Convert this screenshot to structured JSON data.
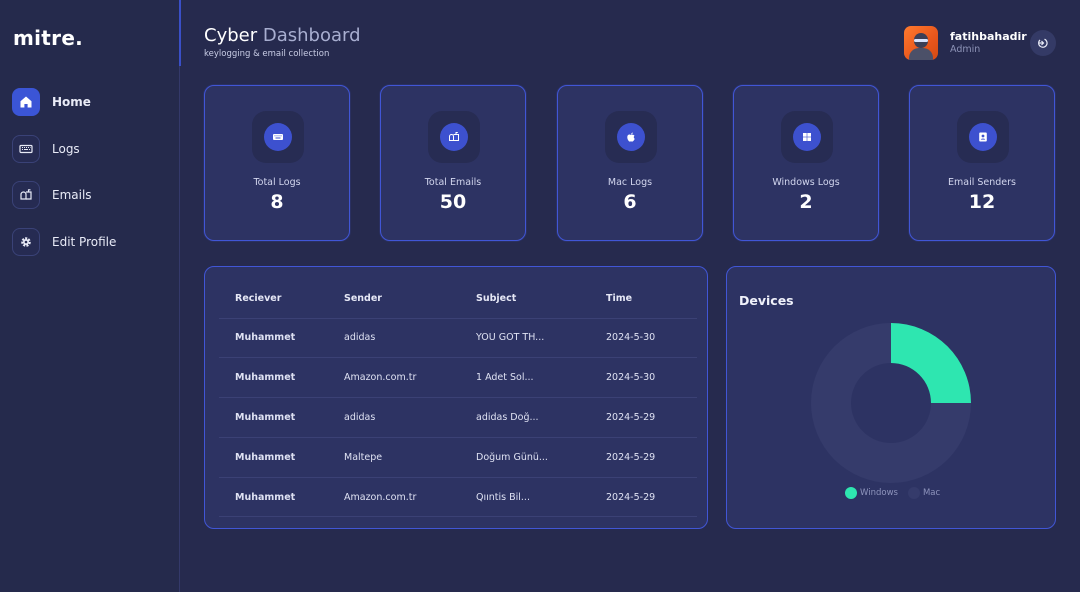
{
  "app": {
    "logo": "mitre."
  },
  "sidebar": {
    "items": [
      {
        "label": "Home",
        "icon": "home-icon",
        "active": true
      },
      {
        "label": "Logs",
        "icon": "keyboard-icon",
        "active": false
      },
      {
        "label": "Emails",
        "icon": "mailbox-icon",
        "active": false
      },
      {
        "label": "Edit Profile",
        "icon": "gear-icon",
        "active": false
      }
    ]
  },
  "header": {
    "title_main": "Cyber",
    "title_accent": "Dashboard",
    "subtitle": "keylogging & email collection"
  },
  "user": {
    "name": "fatihbahadir",
    "role": "Admin"
  },
  "stats": [
    {
      "label": "Total Logs",
      "value": "8",
      "icon": "keyboard-icon"
    },
    {
      "label": "Total Emails",
      "value": "50",
      "icon": "mailbox-icon"
    },
    {
      "label": "Mac Logs",
      "value": "6",
      "icon": "apple-icon"
    },
    {
      "label": "Windows Logs",
      "value": "2",
      "icon": "windows-icon"
    },
    {
      "label": "Email Senders",
      "value": "12",
      "icon": "contact-icon"
    }
  ],
  "emails_table": {
    "headers": [
      "Reciever",
      "Sender",
      "Subject",
      "Time"
    ],
    "rows": [
      [
        "Muhammet",
        "adidas",
        "YOU GOT TH...",
        "2024-5-30"
      ],
      [
        "Muhammet",
        "Amazon.com.tr",
        "1 Adet Sol...",
        "2024-5-30"
      ],
      [
        "Muhammet",
        "adidas",
        "adidas Doğ...",
        "2024-5-29"
      ],
      [
        "Muhammet",
        "Maltepe",
        "Doğum Günü...",
        "2024-5-29"
      ],
      [
        "Muhammet",
        "Amazon.com.tr",
        "Qııntis Bil...",
        "2024-5-29"
      ]
    ]
  },
  "devices": {
    "title": "Devices",
    "colors": {
      "windows": "#2ee6b0",
      "mac": "#353b6b"
    }
  },
  "chart_data": {
    "type": "pie",
    "title": "Devices",
    "categories": [
      "Windows",
      "Mac"
    ],
    "values": [
      2,
      6
    ],
    "donut": true,
    "legend": "bottom"
  }
}
